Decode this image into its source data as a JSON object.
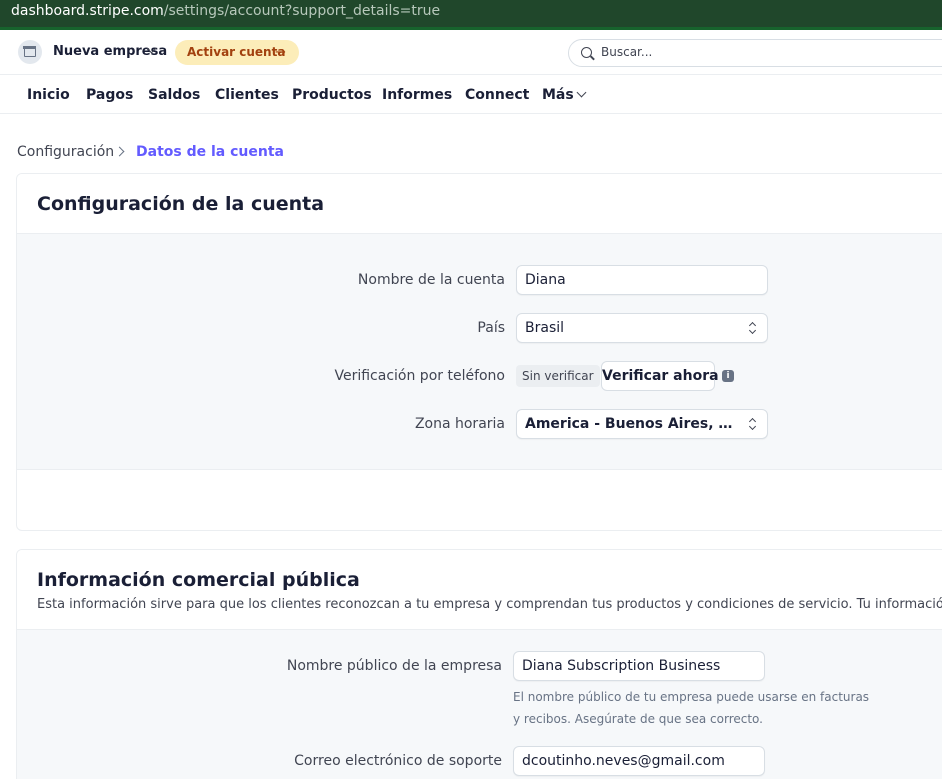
{
  "browser": {
    "url_host": "dashboard.stripe.com",
    "url_path": "/settings/account?support_details=true"
  },
  "topbar": {
    "account_name": "Nueva empresa",
    "activate_label": "Activar cuenta",
    "search_placeholder": "Buscar..."
  },
  "nav": {
    "items": [
      "Inicio",
      "Pagos",
      "Saldos",
      "Clientes",
      "Productos",
      "Informes",
      "Connect",
      "Más"
    ]
  },
  "breadcrumb": {
    "parent": "Configuración",
    "current": "Datos de la cuenta"
  },
  "account_settings": {
    "title": "Configuración de la cuenta",
    "account_name_label": "Nombre de la cuenta",
    "account_name_value": "Diana",
    "country_label": "País",
    "country_value": "Brasil",
    "phone_label": "Verificación por teléfono",
    "phone_status": "Sin verificar",
    "verify_button": "Verificar ahora",
    "info_icon": "info-icon",
    "timezone_label": "Zona horaria",
    "timezone_value": "America - Buenos Aires, Argentina"
  },
  "public_info": {
    "title": "Información comercial pública",
    "subtitle": "Esta información sirve para que los clientes reconozcan a tu empresa y comprendan tus productos y condiciones de servicio. Tu información de s",
    "business_name_label": "Nombre público de la empresa",
    "business_name_value": "Diana Subscription Business",
    "business_name_help_1": "El nombre público de tu empresa puede usarse en facturas",
    "business_name_help_2": "y recibos. Asegúrate de que sea correcto.",
    "support_email_label": "Correo electrónico de soporte",
    "support_email_value": "dcoutinho.neves@gmail.com"
  },
  "colors": {
    "accent": "#635bff",
    "activate_bg": "#fcedb9",
    "activate_text": "#a2410f",
    "browser_bar": "#20472b"
  }
}
